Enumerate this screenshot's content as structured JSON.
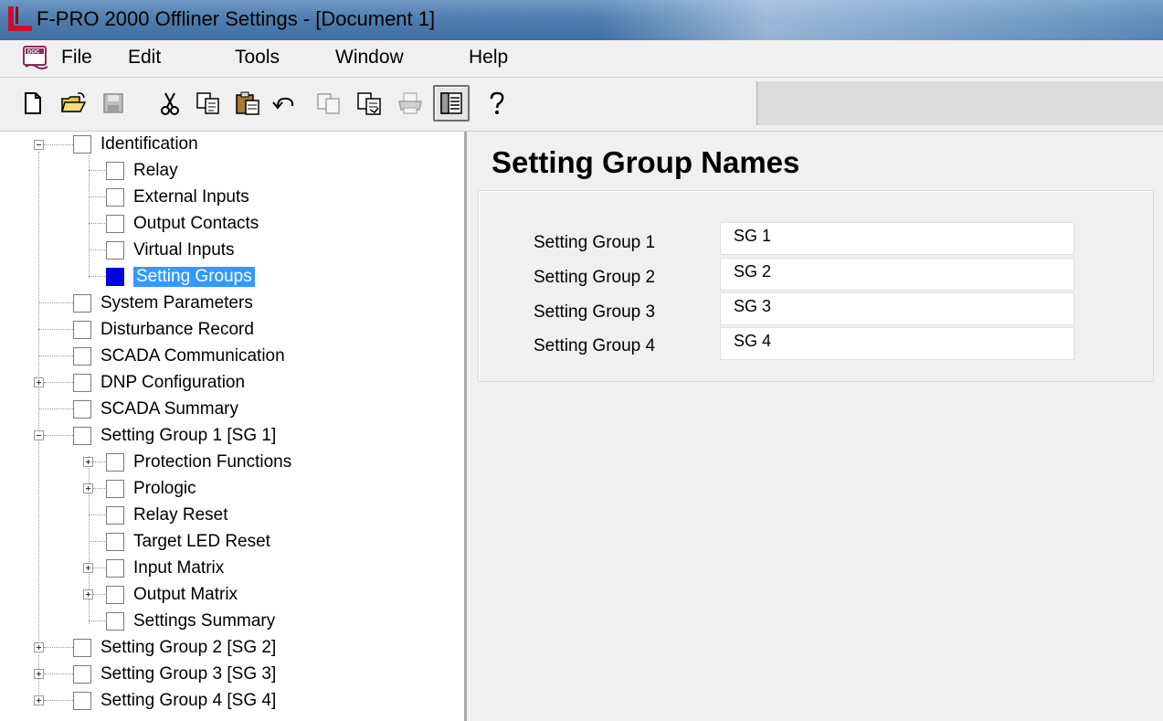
{
  "window": {
    "title": "F-PRO 2000 Offliner Settings - [Document 1]"
  },
  "menu": {
    "icon": "doc-icon",
    "items": [
      {
        "label": "File"
      },
      {
        "label": "Edit"
      },
      {
        "label": "Tools"
      },
      {
        "label": "Window"
      },
      {
        "label": "Help"
      }
    ]
  },
  "toolbar": {
    "buttons": [
      {
        "icon": "new-file-icon"
      },
      {
        "icon": "open-folder-icon"
      },
      {
        "icon": "save-icon",
        "enabled": false
      },
      {
        "icon": "cut-icon"
      },
      {
        "icon": "copy-icon"
      },
      {
        "icon": "paste-icon"
      },
      {
        "icon": "undo-icon"
      },
      {
        "icon": "copy-disabled-icon",
        "enabled": false
      },
      {
        "icon": "compare-icon"
      },
      {
        "icon": "print-icon",
        "enabled": false
      },
      {
        "icon": "view-panel-icon",
        "pressed": true
      },
      {
        "icon": "help-icon"
      }
    ]
  },
  "tree": {
    "items": [
      {
        "label": "Identification",
        "expanded": true
      },
      {
        "label": "Relay"
      },
      {
        "label": "External Inputs"
      },
      {
        "label": "Output Contacts"
      },
      {
        "label": "Virtual Inputs"
      },
      {
        "label": "Setting Groups",
        "selected": true
      },
      {
        "label": "System Parameters"
      },
      {
        "label": "Disturbance Record"
      },
      {
        "label": "SCADA Communication"
      },
      {
        "label": "DNP Configuration",
        "expandable": true
      },
      {
        "label": "SCADA Summary"
      },
      {
        "label": "Setting Group 1 [SG 1]",
        "expanded": true
      },
      {
        "label": "Protection Functions",
        "expandable": true
      },
      {
        "label": "Prologic",
        "expandable": true
      },
      {
        "label": "Relay Reset"
      },
      {
        "label": "Target LED Reset"
      },
      {
        "label": "Input Matrix",
        "expandable": true
      },
      {
        "label": "Output Matrix",
        "expandable": true
      },
      {
        "label": "Settings Summary"
      },
      {
        "label": "Setting Group 2 [SG 2]",
        "expandable": true
      },
      {
        "label": "Setting Group 3 [SG 3]",
        "expandable": true
      },
      {
        "label": "Setting Group 4 [SG 4]",
        "expandable": true
      }
    ]
  },
  "content": {
    "title": "Setting Group Names",
    "fields": [
      {
        "label": "Setting Group 1",
        "value": "SG 1"
      },
      {
        "label": "Setting Group 2",
        "value": "SG 2"
      },
      {
        "label": "Setting Group 3",
        "value": "SG 3"
      },
      {
        "label": "Setting Group 4",
        "value": "SG 4"
      }
    ]
  },
  "colors": {
    "selection_bg": "#3399ff",
    "selected_box": "#0000e0",
    "titlebar": "#4f7fb0"
  }
}
